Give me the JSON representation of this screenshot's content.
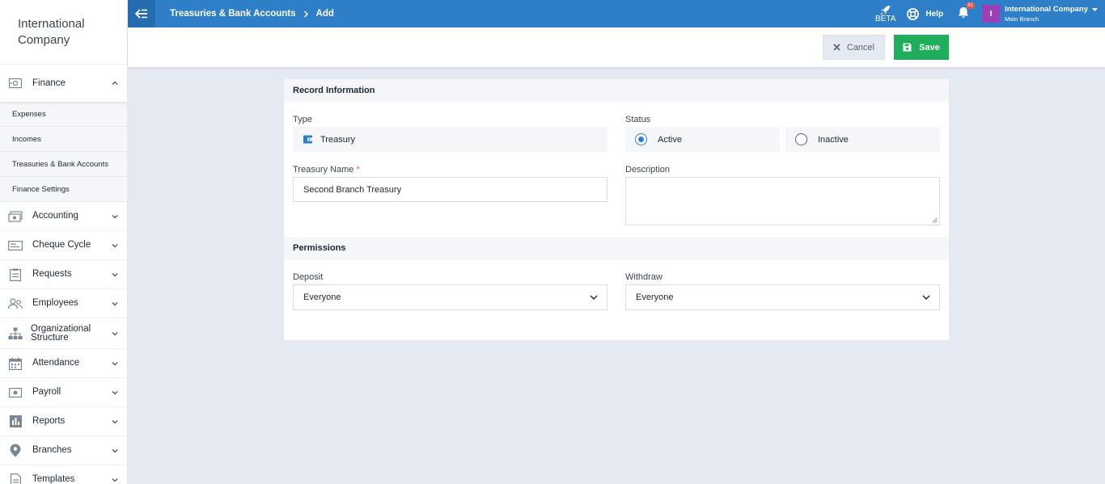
{
  "brand": {
    "line1": "International",
    "line2": "Company"
  },
  "sidebar": {
    "finance": {
      "label": "Finance",
      "icon": "safe-icon"
    },
    "finance_sub": [
      "Expenses",
      "Incomes",
      "Treasuries & Bank Accounts",
      "Finance Settings"
    ],
    "items": [
      {
        "label": "Accounting",
        "icon": "cash-icon"
      },
      {
        "label": "Cheque Cycle",
        "icon": "cheque-icon"
      },
      {
        "label": "Requests",
        "icon": "clipboard-icon"
      },
      {
        "label": "Employees",
        "icon": "people-icon"
      },
      {
        "label": "Organizational",
        "label2": "Structure",
        "icon": "org-chart-icon"
      },
      {
        "label": "Attendance",
        "icon": "calendar-icon"
      },
      {
        "label": "Payroll",
        "icon": "money-icon"
      },
      {
        "label": "Reports",
        "icon": "bar-chart-icon"
      },
      {
        "label": "Branches",
        "icon": "map-pin-icon"
      },
      {
        "label": "Templates",
        "icon": "document-icon"
      }
    ]
  },
  "topbar": {
    "breadcrumb": [
      "Treasuries & Bank Accounts",
      "Add"
    ],
    "beta_label": "BETA",
    "help_label": "Help",
    "notification_count": "61",
    "avatar_letter": "I",
    "company_name": "International Company",
    "branch_name": "Main Branch"
  },
  "actions": {
    "cancel_label": "Cancel",
    "save_label": "Save"
  },
  "form": {
    "record_info_title": "Record Information",
    "type_label": "Type",
    "type_value": "Treasury",
    "status_label": "Status",
    "status_options": [
      "Active",
      "Inactive"
    ],
    "status_selected": "Active",
    "name_label": "Treasury Name",
    "name_required": "*",
    "name_value": "Second Branch Treasury",
    "description_label": "Description",
    "description_value": "",
    "permissions_title": "Permissions",
    "deposit_label": "Deposit",
    "deposit_value": "Everyone",
    "withdraw_label": "Withdraw",
    "withdraw_value": "Everyone"
  },
  "colors": {
    "primary": "#2e7ec8",
    "success": "#1fae5b",
    "avatar": "#9b3fb8",
    "badge": "#e2554f"
  }
}
